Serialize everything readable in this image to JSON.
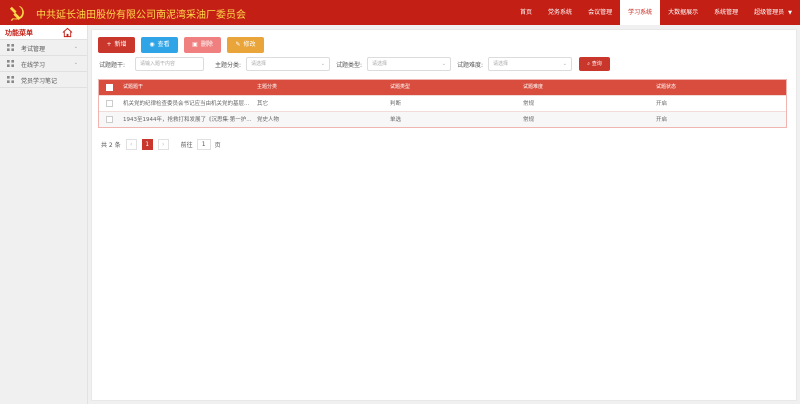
{
  "header": {
    "org_title": "中共延长油田股份有限公司南泥湾采油厂委员会",
    "nav": [
      {
        "label": "首页",
        "active": false
      },
      {
        "label": "党务系统",
        "active": false
      },
      {
        "label": "会议管理",
        "active": false
      },
      {
        "label": "学习系统",
        "active": true
      },
      {
        "label": "大数据展示",
        "active": false
      },
      {
        "label": "系统管理",
        "active": false
      },
      {
        "label": "超级管理员",
        "active": false
      }
    ],
    "user_caret": "▼"
  },
  "sidebar": {
    "title": "功能菜单",
    "items": [
      {
        "label": "考试管理",
        "icon": "grid-icon",
        "chevron": "⌄"
      },
      {
        "label": "在线学习",
        "icon": "grid-icon",
        "chevron": "⌄"
      },
      {
        "label": "党员学习笔记",
        "icon": "grid-icon",
        "chevron": ""
      }
    ]
  },
  "toolbar": {
    "add_label": "新增",
    "view_label": "查看",
    "delete_label": "删除",
    "edit_label": "修改"
  },
  "filters": {
    "stem_label": "试题题干:",
    "stem_placeholder": "请输入题干内容",
    "category_label": "主题分类:",
    "category_placeholder": "请选择",
    "type_label": "试题类型:",
    "type_placeholder": "请选择",
    "difficulty_label": "试题难度:",
    "difficulty_placeholder": "请选择",
    "search_label": "查询"
  },
  "table": {
    "columns": [
      "试题题干",
      "主题分类",
      "试题类型",
      "试题难度",
      "试题状态"
    ],
    "rows": [
      [
        "机关党的纪律检查委员会书记应当由机关党的基层...",
        "其它",
        "判断",
        "常规",
        "开启"
      ],
      [
        "1943至1944年，抢救打和发展了《沉思集·第一护...",
        "党史人物",
        "单选",
        "常规",
        "开启"
      ]
    ]
  },
  "pager": {
    "total_text": "共 2 条",
    "prev": "‹",
    "current": "1",
    "next": "›",
    "goto_label": "前往",
    "goto_value": "1",
    "unit": "页"
  },
  "colors": {
    "brand_red": "#c41f15",
    "title_gold": "#ffd84a",
    "table_header": "#d84d3e"
  }
}
